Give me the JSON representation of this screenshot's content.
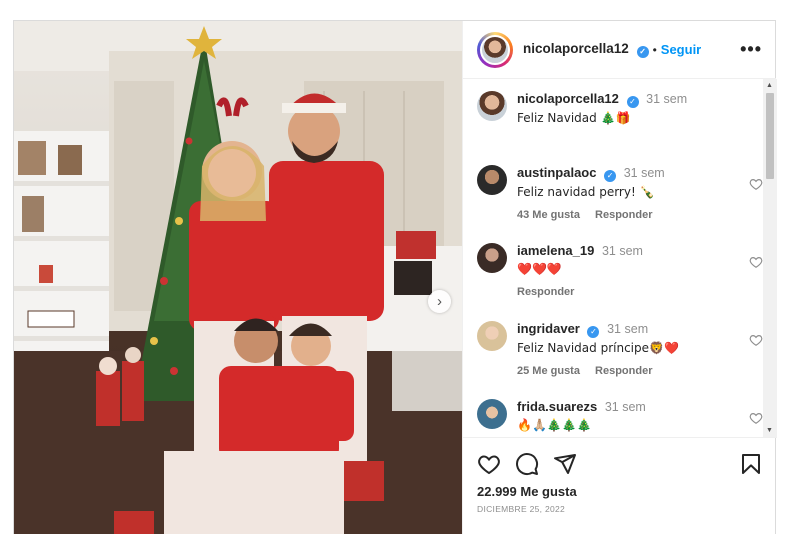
{
  "post": {
    "author": "nicolaporcella12",
    "follow_label": "Seguir",
    "dot": "•",
    "more": "•••",
    "next_arrow": "›"
  },
  "comments": [
    {
      "user": "nicolaporcella12",
      "time": "31 sem",
      "text": "Feliz Navidad 🎄🎁",
      "verified": true,
      "likes": "",
      "reply": ""
    },
    {
      "user": "austinpalaoc",
      "time": "31 sem",
      "text": "Feliz navidad perry! 🍾",
      "verified": true,
      "likes": "43 Me gusta",
      "reply": "Responder"
    },
    {
      "user": "iamelena_19",
      "time": "31 sem",
      "text": "❤️❤️❤️",
      "verified": false,
      "likes": "",
      "reply": "Responder"
    },
    {
      "user": "ingridaver",
      "time": "31 sem",
      "text": "Feliz Navidad príncipe🦁❤️",
      "verified": true,
      "likes": "25 Me gusta",
      "reply": "Responder"
    },
    {
      "user": "frida.suarezs",
      "time": "31 sem",
      "text": "🔥🙏🏼🎄🎄🎄",
      "verified": false,
      "likes": "",
      "reply": ""
    }
  ],
  "footer": {
    "likes_count": "22.999 Me gusta",
    "date": "DICIEMBRE 25, 2022"
  },
  "icons": [
    "heart-icon",
    "comment-icon",
    "share-icon",
    "bookmark-icon",
    "verified-icon",
    "more-icon"
  ]
}
